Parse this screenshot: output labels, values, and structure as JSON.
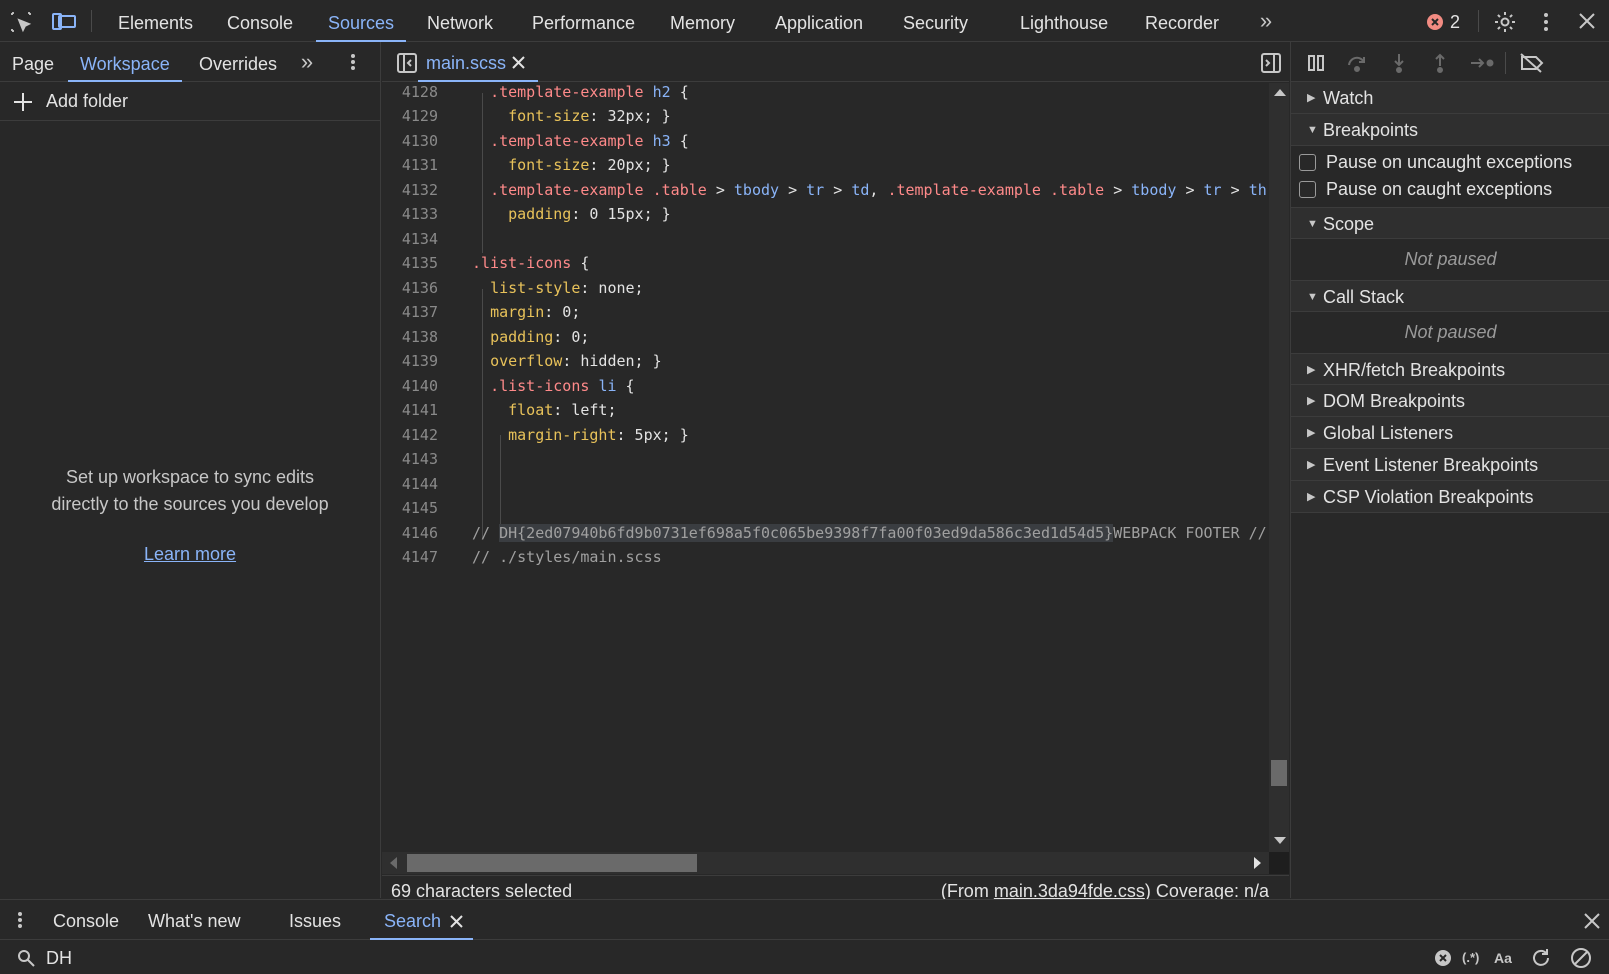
{
  "toolbar": {
    "tabs": [
      {
        "label": "Elements"
      },
      {
        "label": "Console"
      },
      {
        "label": "Sources"
      },
      {
        "label": "Network"
      },
      {
        "label": "Performance"
      },
      {
        "label": "Memory"
      },
      {
        "label": "Application"
      },
      {
        "label": "Security"
      },
      {
        "label": "Lighthouse"
      },
      {
        "label": "Recorder"
      }
    ],
    "active_tab": "Sources",
    "error_count": "2",
    "icons": [
      "inspect-element-icon",
      "device-toolbar-icon",
      "more-tabs-icon",
      "error-icon",
      "settings-icon",
      "kebab-menu-icon",
      "close-icon"
    ]
  },
  "navigator": {
    "tabs": [
      {
        "label": "Page"
      },
      {
        "label": "Workspace"
      },
      {
        "label": "Overrides"
      }
    ],
    "active_tab": "Workspace",
    "add_folder_label": "Add folder",
    "empty_message_line1": "Set up workspace to sync edits",
    "empty_message_line2": "directly to the sources you develop",
    "learn_more_link": "Learn more"
  },
  "editor": {
    "file_tab": "main.scss",
    "lines": [
      {
        "num": "4128",
        "text": "  .template-example h2 {"
      },
      {
        "num": "4129",
        "text": "    font-size: 32px; }"
      },
      {
        "num": "4130",
        "text": "  .template-example h3 {"
      },
      {
        "num": "4131",
        "text": "    font-size: 20px; }"
      },
      {
        "num": "4132",
        "text": "  .template-example .table > tbody > tr > td, .template-example .table > tbody > tr > th"
      },
      {
        "num": "4133",
        "text": "    padding: 0 15px; }"
      },
      {
        "num": "4134",
        "text": ""
      },
      {
        "num": "4135",
        "text": ".list-icons {"
      },
      {
        "num": "4136",
        "text": "  list-style: none;"
      },
      {
        "num": "4137",
        "text": "  margin: 0;"
      },
      {
        "num": "4138",
        "text": "  padding: 0;"
      },
      {
        "num": "4139",
        "text": "  overflow: hidden; }"
      },
      {
        "num": "4140",
        "text": "  .list-icons li {"
      },
      {
        "num": "4141",
        "text": "    float: left;"
      },
      {
        "num": "4142",
        "text": "    margin-right: 5px; }"
      },
      {
        "num": "4143",
        "text": ""
      },
      {
        "num": "4144",
        "text": ""
      },
      {
        "num": "4145",
        "text": ""
      },
      {
        "num": "4146",
        "text": "// DH{2ed07940b6fd9b0731ef698a5f0c065be9398f7fa00f03ed9da586c3ed1d54d5}WEBPACK FOOTER //"
      },
      {
        "num": "4147",
        "text": "// ./styles/main.scss"
      }
    ],
    "status_selected": "69 characters selected",
    "status_from_prefix": "(From ",
    "status_from_link": "main.3da94fde.css",
    "status_from_suffix": ") Coverage: n/a"
  },
  "debugger": {
    "sections": {
      "watch": "Watch",
      "breakpoints": "Breakpoints",
      "scope": "Scope",
      "call_stack": "Call Stack",
      "xhr": "XHR/fetch Breakpoints",
      "dom": "DOM Breakpoints",
      "global": "Global Listeners",
      "event": "Event Listener Breakpoints",
      "csp": "CSP Violation Breakpoints"
    },
    "pause_uncaught": "Pause on uncaught exceptions",
    "pause_caught": "Pause on caught exceptions",
    "scope_status": "Not paused",
    "callstack_status": "Not paused"
  },
  "drawer": {
    "tabs": [
      {
        "label": "Console"
      },
      {
        "label": "What's new"
      },
      {
        "label": "Issues"
      },
      {
        "label": "Search"
      }
    ],
    "active_tab": "Search",
    "search_value": "DH",
    "regex_label": "(.*)",
    "case_label": "Aa"
  },
  "colors": {
    "accent": "#8ab4f8",
    "error": "#f28b82",
    "background": "#282828",
    "property": "#e8c25a"
  }
}
